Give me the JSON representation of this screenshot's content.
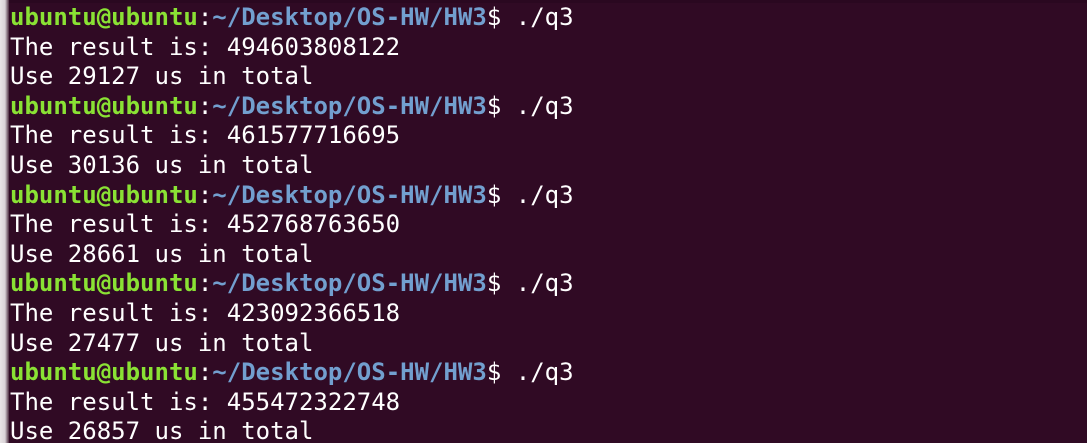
{
  "terminal": {
    "user_host": "ubuntu@ubuntu",
    "separator": ":",
    "path": "~/Desktop/OS-HW/HW3",
    "dollar": "$",
    "runs": [
      {
        "command": " ./q3",
        "result_line": "The result is: 494603808122",
        "time_line": "Use 29127 us in total"
      },
      {
        "command": " ./q3",
        "result_line": "The result is: 461577716695",
        "time_line": "Use 30136 us in total"
      },
      {
        "command": " ./q3",
        "result_line": "The result is: 452768763650",
        "time_line": "Use 28661 us in total"
      },
      {
        "command": " ./q3",
        "result_line": "The result is: 423092366518",
        "time_line": "Use 27477 us in total"
      },
      {
        "command": " ./q3",
        "result_line": "The result is: 455472322748",
        "time_line": "Use 26857 us in total"
      }
    ]
  },
  "colors": {
    "background": "#300a24",
    "prompt_user": "#8ae234",
    "prompt_path": "#729fcf",
    "text": "#ffffff"
  }
}
